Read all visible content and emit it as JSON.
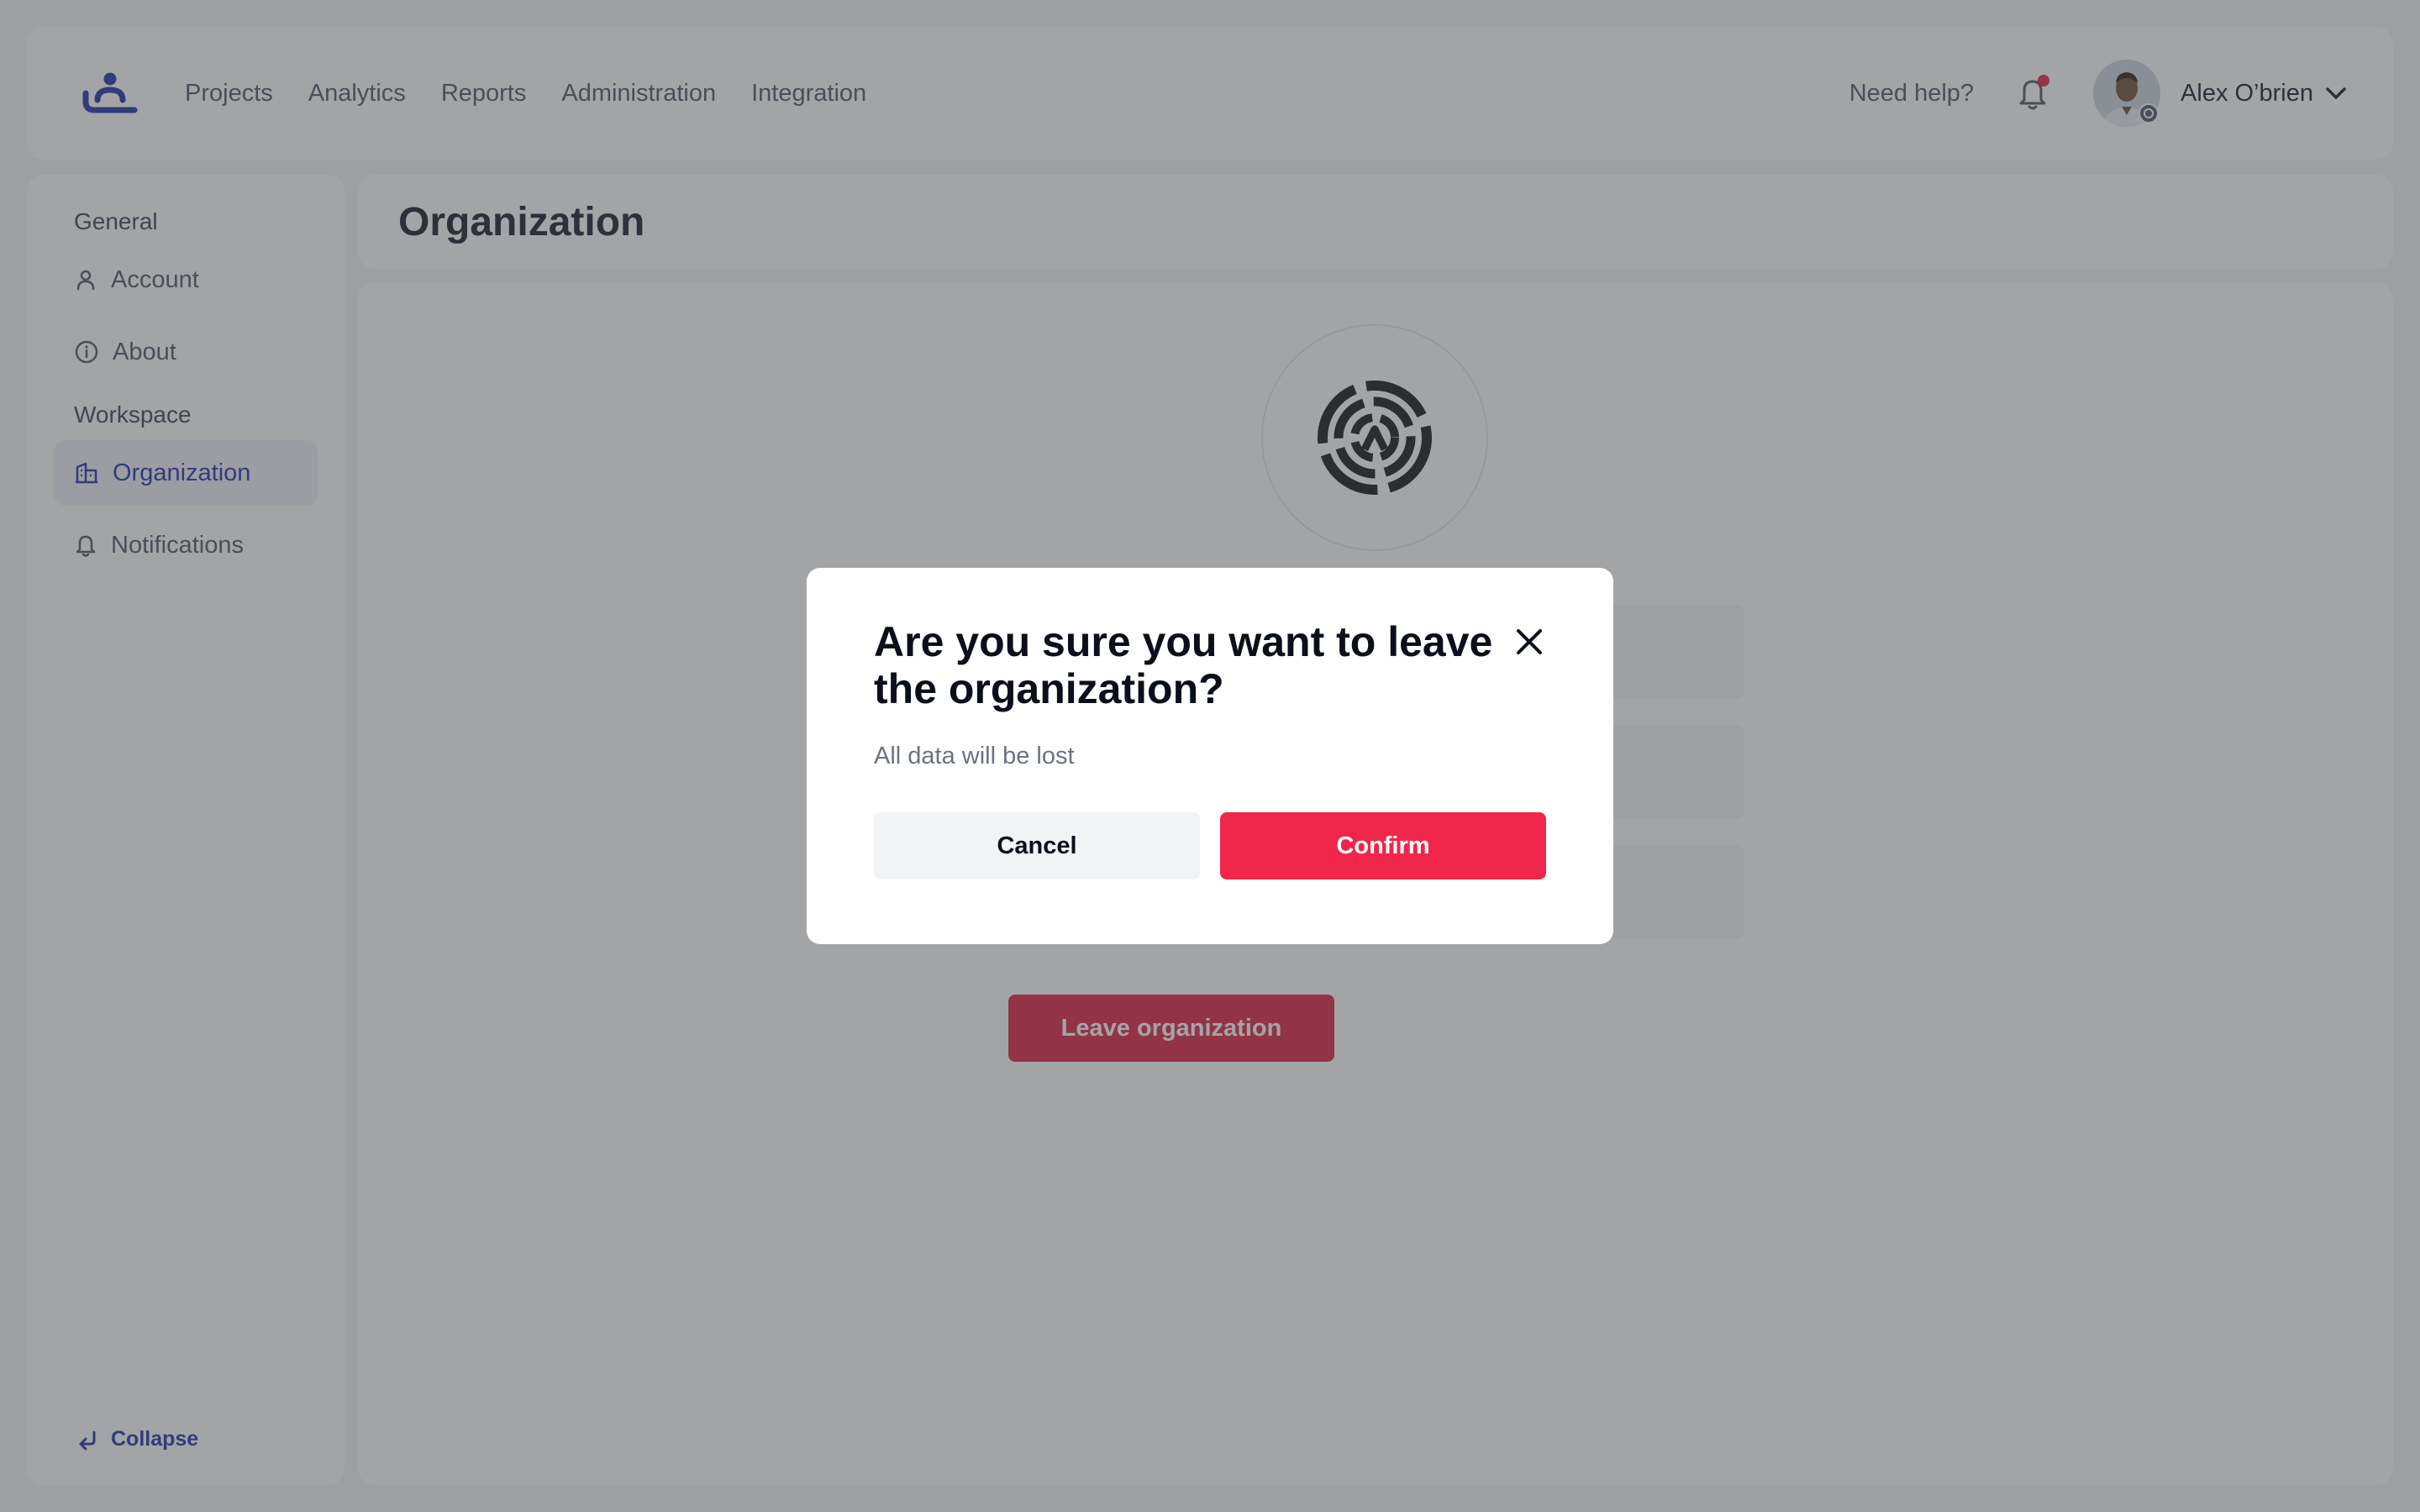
{
  "topbar": {
    "nav": [
      "Projects",
      "Analytics",
      "Reports",
      "Administration",
      "Integration"
    ],
    "help": "Need help?",
    "user_name": "Alex O’brien"
  },
  "sidebar": {
    "general_title": "General",
    "general_items": [
      "Account",
      "About"
    ],
    "workspace_title": "Workspace",
    "workspace_items": [
      "Organization",
      "Notifications"
    ],
    "active_item": "Organization",
    "collapse": "Collapse"
  },
  "page": {
    "title": "Organization",
    "leave_button": "Leave organization"
  },
  "modal": {
    "title": "Are you sure you want to leave the organization?",
    "subtitle": "All data will be lost",
    "cancel": "Cancel",
    "confirm": "Confirm"
  },
  "colors": {
    "brand": "#1d2fa8",
    "danger": "#f0254a",
    "notification_dot": "#e11d48"
  },
  "icons": [
    "brand-logo-icon",
    "bell-icon",
    "chevron-down-icon",
    "user-icon",
    "info-icon",
    "building-icon",
    "bell-icon",
    "collapse-arrow-icon",
    "org-emblem-icon",
    "close-icon"
  ]
}
